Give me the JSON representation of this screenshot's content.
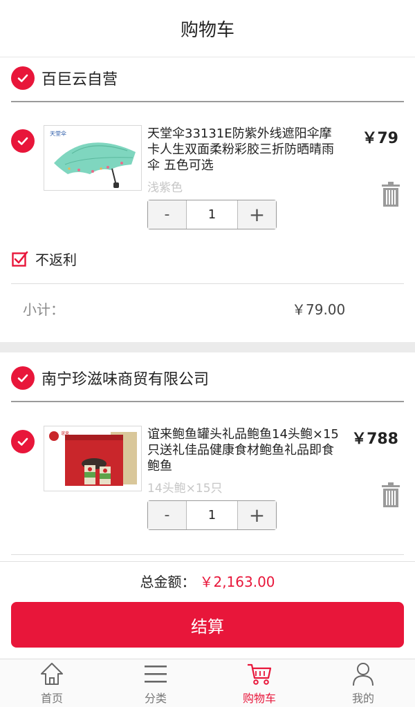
{
  "header": {
    "title": "购物车"
  },
  "shops": [
    {
      "name": "百巨云自营",
      "item": {
        "title": "天堂伞33131E防紫外线遮阳伞摩卡人生双面柔粉彩胶三折防晒晴雨伞 五色可选",
        "spec": "浅紫色",
        "price": "￥79",
        "quantity": "1",
        "thumb_icon": "umbrella-photo"
      },
      "no_rebate_label": "不返利",
      "subtotal_label": "小计：",
      "subtotal_value": "￥79.00"
    },
    {
      "name": "南宁珍滋味商贸有限公司",
      "item": {
        "title": "谊来鲍鱼罐头礼品鲍鱼14头鲍×15只送礼佳品健康食材鲍鱼礼品即食鲍鱼",
        "spec": "14头鲍×15只",
        "price": "￥788",
        "quantity": "1",
        "thumb_icon": "abalone-gift-box-photo"
      }
    }
  ],
  "stepper": {
    "minus": "-",
    "plus": "+"
  },
  "footer": {
    "total_label": "总金额：",
    "total_value": "￥2,163.00",
    "checkout_label": "结算"
  },
  "tabs": [
    {
      "label": "首页",
      "icon": "home-icon"
    },
    {
      "label": "分类",
      "icon": "menu-icon"
    },
    {
      "label": "购物车",
      "icon": "cart-icon",
      "active": true
    },
    {
      "label": "我的",
      "icon": "user-icon"
    }
  ],
  "colors": {
    "accent": "#e8163a",
    "divider": "#9a9a9a",
    "band": "#ebebeb"
  }
}
